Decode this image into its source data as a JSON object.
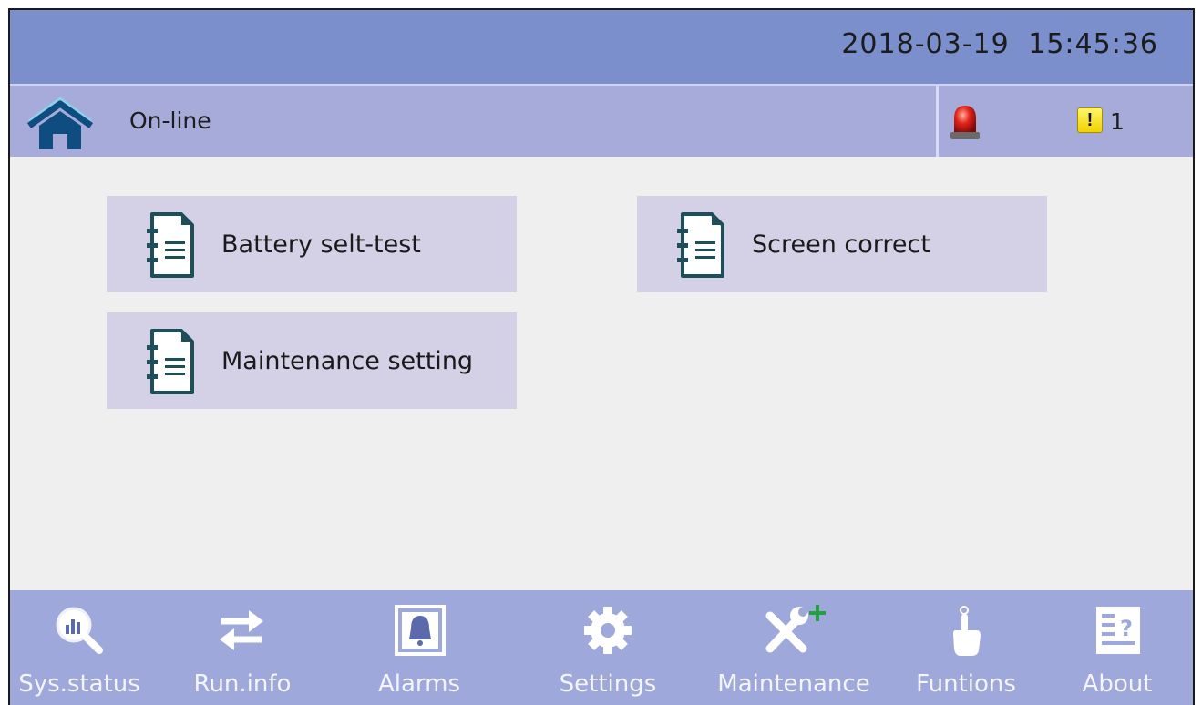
{
  "header": {
    "date": "2018-03-19",
    "time": "15:45:36"
  },
  "status": {
    "home_icon": "home-icon",
    "mode": "On-line",
    "alarm_icon": "alarm-beacon-icon",
    "warning_badge": "!",
    "warning_count": "1"
  },
  "menu": {
    "items": [
      {
        "label": "Battery selt-test",
        "icon": "document-icon"
      },
      {
        "label": "Screen correct",
        "icon": "document-icon"
      },
      {
        "label": "Maintenance setting",
        "icon": "document-icon"
      }
    ]
  },
  "nav": {
    "items": [
      {
        "label": "Sys.status",
        "icon": "magnifier-chart-icon"
      },
      {
        "label": "Run.info",
        "icon": "swap-arrows-icon"
      },
      {
        "label": "Alarms",
        "icon": "bell-icon"
      },
      {
        "label": "Settings",
        "icon": "gear-icon"
      },
      {
        "label": "Maintenance",
        "icon": "tools-icon"
      },
      {
        "label": "Funtions",
        "icon": "pointing-hand-icon"
      },
      {
        "label": "About",
        "icon": "help-document-icon"
      }
    ]
  },
  "colors": {
    "topbar": "#7a8fcb",
    "statusbar": "#a6abda",
    "menu_button": "#d4d0e6",
    "bottombar": "#9ea8da",
    "icon_teal": "#1d4f5a",
    "home_blue": "#0f4d80"
  }
}
